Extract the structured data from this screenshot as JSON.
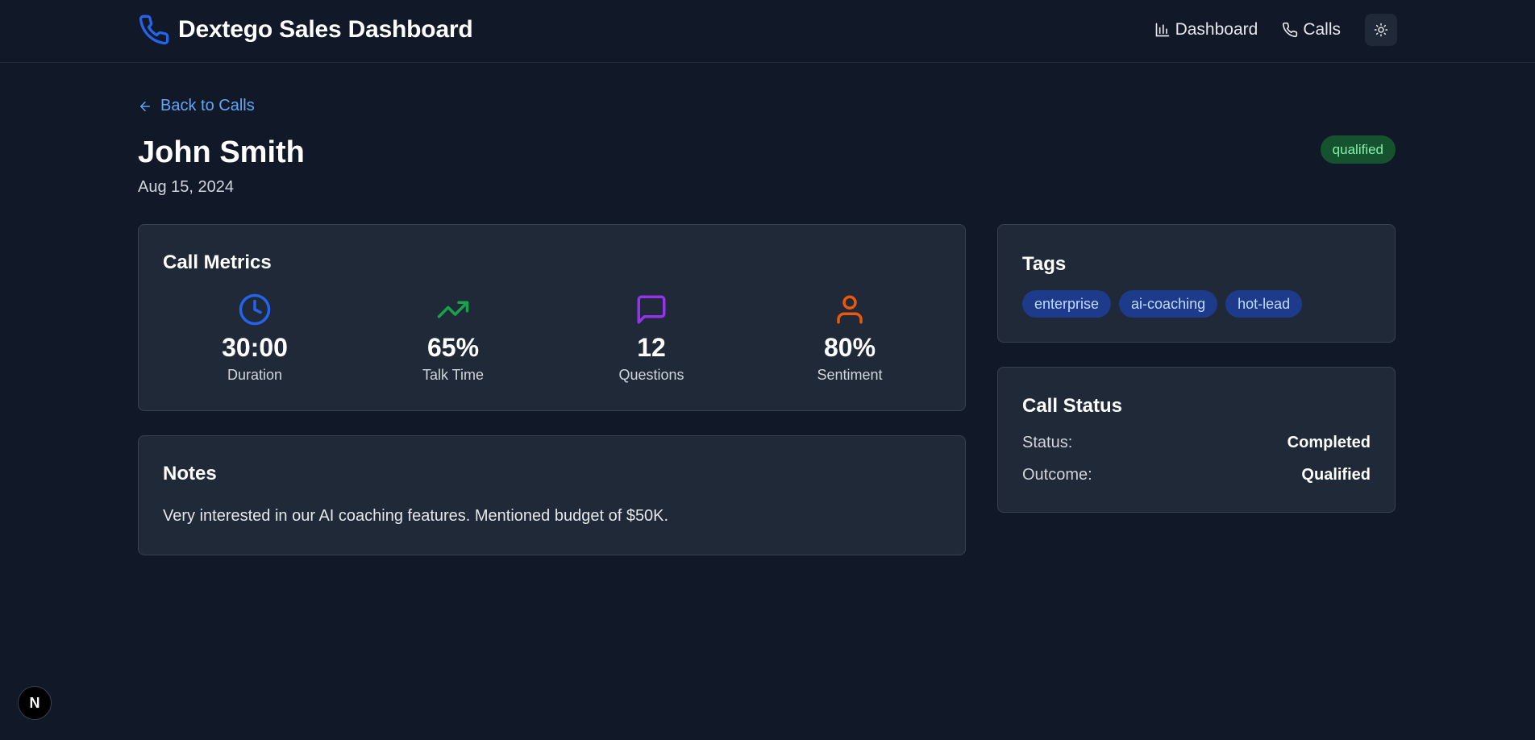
{
  "header": {
    "brand_title": "Dextego Sales Dashboard",
    "brand_icon": "phone-icon",
    "nav": [
      {
        "label": "Dashboard",
        "icon": "bar-chart-icon"
      },
      {
        "label": "Calls",
        "icon": "phone-icon"
      }
    ],
    "theme_toggle_icon": "sun-icon"
  },
  "back_link": {
    "label": "Back to Calls",
    "icon": "arrow-left-icon"
  },
  "call": {
    "name": "John Smith",
    "date": "Aug 15, 2024",
    "status_badge": "qualified"
  },
  "metrics": {
    "title": "Call Metrics",
    "items": [
      {
        "value": "30:00",
        "label": "Duration",
        "icon": "clock-icon",
        "color": "#2563eb"
      },
      {
        "value": "65%",
        "label": "Talk Time",
        "icon": "trending-up-icon",
        "color": "#16a34a"
      },
      {
        "value": "12",
        "label": "Questions",
        "icon": "message-square-icon",
        "color": "#9333ea"
      },
      {
        "value": "80%",
        "label": "Sentiment",
        "icon": "user-icon",
        "color": "#ea580c"
      }
    ]
  },
  "notes": {
    "title": "Notes",
    "text": "Very interested in our AI coaching features. Mentioned budget of $50K."
  },
  "tags": {
    "title": "Tags",
    "items": [
      "enterprise",
      "ai-coaching",
      "hot-lead"
    ]
  },
  "call_status": {
    "title": "Call Status",
    "rows": [
      {
        "label": "Status:",
        "value": "Completed"
      },
      {
        "label": "Outcome:",
        "value": "Qualified"
      }
    ]
  },
  "dev_badge": {
    "label": "N",
    "icon": "nextjs-logo-icon"
  },
  "colors": {
    "background": "#111827",
    "card": "#1f2937",
    "accent": "#60a5fa",
    "badge_green_bg": "#14532d",
    "badge_green_text": "#86efac",
    "tag_bg": "#1e3a8a",
    "tag_text": "#bfdbfe"
  }
}
